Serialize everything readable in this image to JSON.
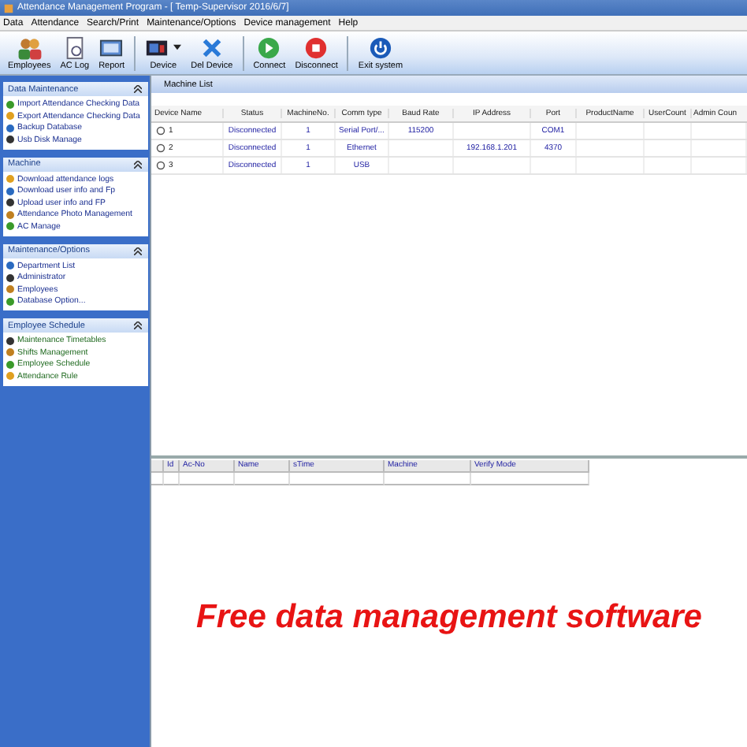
{
  "window": {
    "title": "Attendance Management Program - [ Temp-Supervisor 2016/6/7]"
  },
  "menu": [
    "Data",
    "Attendance",
    "Search/Print",
    "Maintenance/Options",
    "Device management",
    "Help"
  ],
  "toolbar": [
    {
      "label": "Employees",
      "kind": "people"
    },
    {
      "label": "AC Log",
      "kind": "log"
    },
    {
      "label": "Report",
      "kind": "report"
    },
    {
      "label": "Device",
      "kind": "device"
    },
    {
      "label": "Del Device",
      "kind": "delete"
    },
    {
      "label": "Connect",
      "kind": "connect"
    },
    {
      "label": "Disconnect",
      "kind": "disconnect"
    },
    {
      "label": "Exit system",
      "kind": "exit"
    }
  ],
  "sidebar": [
    {
      "title": "Data Maintenance",
      "items": [
        "Import Attendance Checking Data",
        "Export Attendance Checking Data",
        "Backup Database",
        "Usb Disk Manage"
      ]
    },
    {
      "title": "Machine",
      "items": [
        "Download attendance logs",
        "Download user info and Fp",
        "Upload user info and FP",
        "Attendance Photo Management",
        "AC Manage"
      ]
    },
    {
      "title": "Maintenance/Options",
      "items": [
        "Department List",
        "Administrator",
        "Employees",
        "Database Option..."
      ]
    },
    {
      "title": "Employee Schedule",
      "items": [
        "Maintenance Timetables",
        "Shifts Management",
        "Employee Schedule",
        "Attendance Rule"
      ]
    }
  ],
  "machine_list": {
    "title": "Machine List",
    "columns": [
      "Device Name",
      "Status",
      "MachineNo.",
      "Comm type",
      "Baud Rate",
      "IP Address",
      "Port",
      "ProductName",
      "UserCount",
      "Admin Coun"
    ],
    "rows": [
      [
        "1",
        "Disconnected",
        "1",
        "Serial Port/...",
        "115200",
        "",
        "COM1",
        "",
        "",
        ""
      ],
      [
        "2",
        "Disconnected",
        "1",
        "Ethernet",
        "",
        "192.168.1.201",
        "4370",
        "",
        "",
        ""
      ],
      [
        "3",
        "Disconnected",
        "1",
        "USB",
        "",
        "",
        "",
        "",
        "",
        ""
      ]
    ]
  },
  "log_table": {
    "columns": [
      "Id",
      "Ac-No",
      "Name",
      "sTime",
      "Machine",
      "Verify Mode"
    ]
  },
  "banner": "Free data management software"
}
